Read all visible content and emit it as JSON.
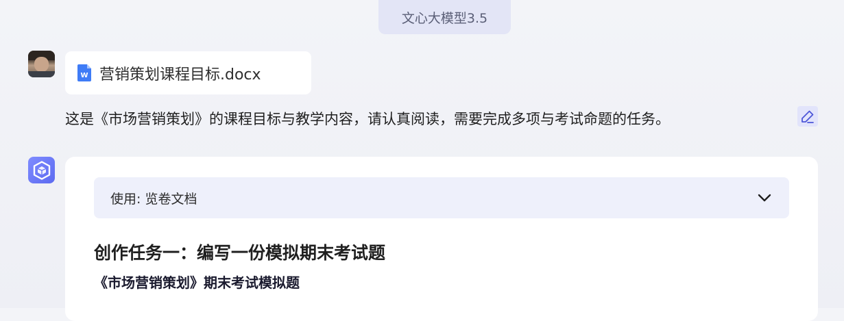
{
  "header": {
    "model_name": "文心大模型3.5"
  },
  "user_turn": {
    "avatar_icon": "user-photo-avatar",
    "attachment": {
      "icon": "word-doc-icon",
      "icon_letter": "W",
      "file_name": "营销策划课程目标.docx"
    },
    "message": "这是《市场营销策划》的课程目标与教学内容，请认真阅读，需要完成多项与考试命题的任务。",
    "edit_icon": "pencil-icon"
  },
  "bot_turn": {
    "avatar_icon": "ernie-cube-logo",
    "tool_usage": {
      "label": "使用: 览卷文档",
      "expand_icon": "chevron-down-icon"
    },
    "task_heading": "创作任务一：编写一份模拟期末考试题",
    "exam_title": "《市场营销策划》期末考试模拟题"
  },
  "colors": {
    "accent": "#5c6af0",
    "badge_bg": "#e3e5f6",
    "tool_bar_bg": "#eef0fb",
    "doc_icon": "#3f7cf6"
  }
}
